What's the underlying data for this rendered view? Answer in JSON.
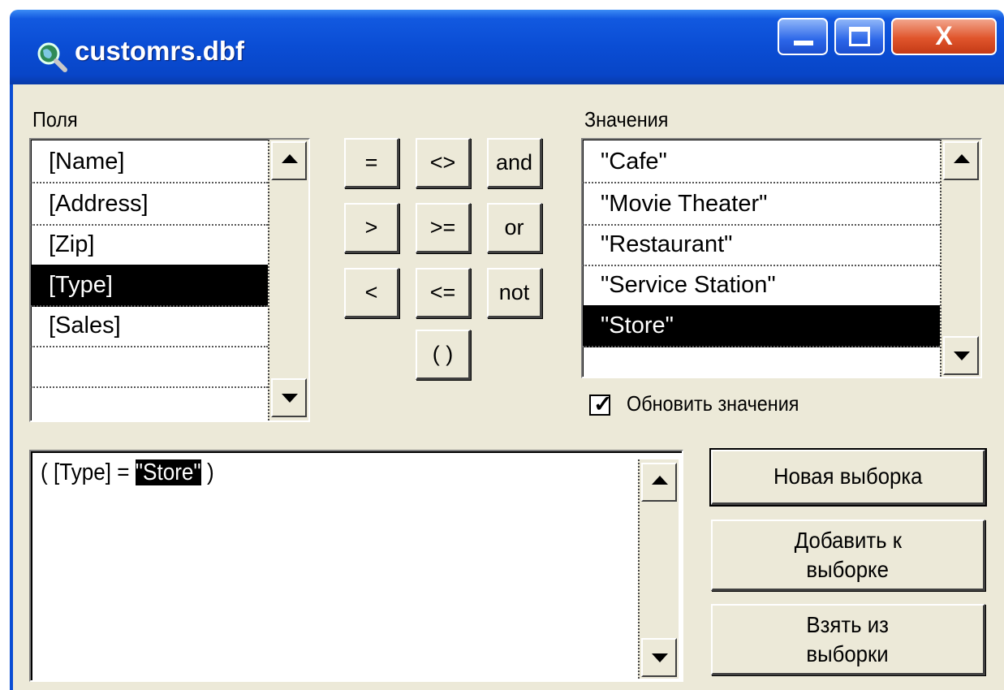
{
  "window": {
    "title": "customrs.dbf",
    "close_glyph": "X"
  },
  "fields": {
    "label": "Поля",
    "items": [
      "[Name]",
      "[Address]",
      "[Zip]",
      "[Type]",
      "[Sales]"
    ],
    "selected": "[Type]"
  },
  "operators": {
    "eq": "=",
    "ne": "<>",
    "and": "and",
    "gt": ">",
    "ge": ">=",
    "or": "or",
    "lt": "<",
    "le": "<=",
    "not": "not",
    "parens": "( )"
  },
  "values": {
    "label": "Значения",
    "items": [
      "\"Cafe\"",
      "\"Movie Theater\"",
      "\"Restaurant\"",
      "\"Service Station\"",
      "\"Store\""
    ],
    "selected": "\"Store\""
  },
  "update_values": {
    "label": "Обновить значения",
    "checked": true
  },
  "expression": {
    "prefix": "( [Type] = ",
    "highlighted": "\"Store\"",
    "suffix": " )"
  },
  "actions": {
    "new_selection": "Новая выборка",
    "add_to_selection_line1": "Добавить к",
    "add_to_selection_line2": "выборке",
    "select_from_line1": "Взять из",
    "select_from_line2": "выборки"
  },
  "colors": {
    "title_bar": "#0a4dd4",
    "face": "#ece9d8",
    "selection": "#000000"
  },
  "icons": [
    "app-globe-magnifier-icon",
    "minimize-icon",
    "maximize-icon",
    "close-icon",
    "scroll-up-arrow-icon",
    "scroll-down-arrow-icon",
    "checkmark-icon"
  ]
}
